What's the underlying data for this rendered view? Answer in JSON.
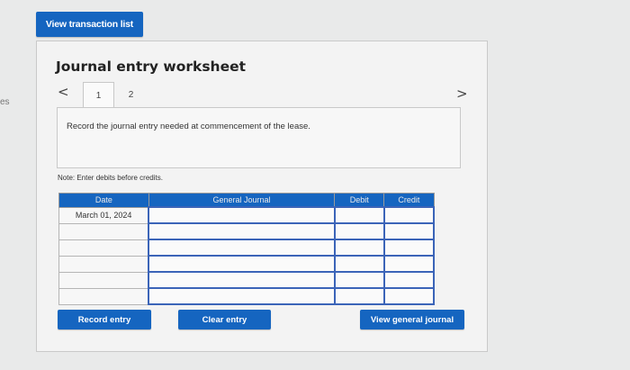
{
  "side_fragment": "es",
  "header": {
    "view_transaction_label": "View transaction list"
  },
  "worksheet": {
    "title": "Journal entry worksheet",
    "tabs": [
      {
        "label": "1"
      },
      {
        "label": "2"
      }
    ],
    "nav_prev": "<",
    "nav_next": ">",
    "instruction": "Record the journal entry needed at commencement of the lease.",
    "note": "Note: Enter debits before credits.",
    "table": {
      "columns": [
        "Date",
        "General Journal",
        "Debit",
        "Credit"
      ],
      "rows": [
        {
          "date": "March 01, 2024",
          "account": "",
          "debit": "",
          "credit": ""
        },
        {
          "date": "",
          "account": "",
          "debit": "",
          "credit": ""
        },
        {
          "date": "",
          "account": "",
          "debit": "",
          "credit": ""
        },
        {
          "date": "",
          "account": "",
          "debit": "",
          "credit": ""
        },
        {
          "date": "",
          "account": "",
          "debit": "",
          "credit": ""
        },
        {
          "date": "",
          "account": "",
          "debit": "",
          "credit": ""
        }
      ]
    },
    "buttons": {
      "record": "Record entry",
      "clear": "Clear entry",
      "view_general": "View general journal"
    }
  },
  "colors": {
    "accent": "#1565c0",
    "input_border": "#3b64b8"
  }
}
